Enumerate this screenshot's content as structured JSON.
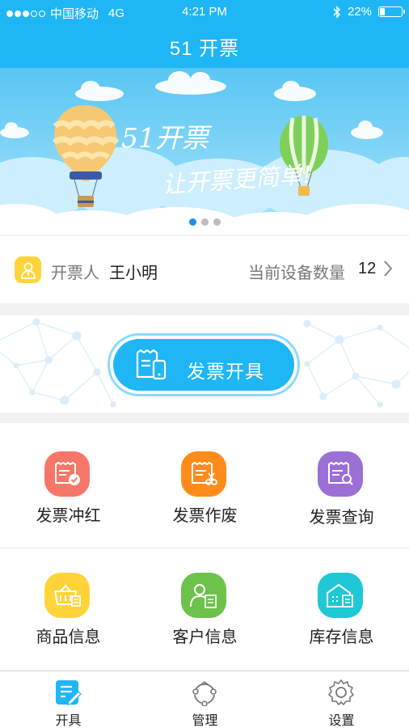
{
  "status": {
    "carrier": "中国移动",
    "network": "4G",
    "time": "4:21 PM",
    "battery": "22%",
    "battery_level": 0.22
  },
  "header": {
    "title": "51 开票"
  },
  "banner": {
    "line1": "51开票",
    "line2": "让开票更简单!",
    "page_count": 3,
    "active_page": 1
  },
  "issuer": {
    "label": "开票人",
    "name": "王小明",
    "device_label": "当前设备数量",
    "device_count": "12"
  },
  "issue_button": {
    "label": "发票开具"
  },
  "grid": {
    "items": [
      {
        "label": "发票冲红",
        "icon": "invoice-check-icon",
        "color": "#f7766a"
      },
      {
        "label": "发票作废",
        "icon": "invoice-cut-icon",
        "color": "#ff8c1a"
      },
      {
        "label": "发票查询",
        "icon": "invoice-search-icon",
        "color": "#9b6fd6"
      },
      {
        "label": "商品信息",
        "icon": "basket-icon",
        "color": "#ffd43b"
      },
      {
        "label": "客户信息",
        "icon": "customer-icon",
        "color": "#6cc24a"
      },
      {
        "label": "库存信息",
        "icon": "warehouse-icon",
        "color": "#1ec8d6"
      }
    ]
  },
  "tabbar": {
    "tabs": [
      {
        "label": "开具",
        "icon": "issue-tab-icon",
        "active": true
      },
      {
        "label": "管理",
        "icon": "manage-tab-icon",
        "active": false
      },
      {
        "label": "设置",
        "icon": "settings-tab-icon",
        "active": false
      }
    ]
  },
  "colors": {
    "primary": "#1fb6f5",
    "accent_light": "#8ad9fb",
    "pager_active": "#1e90e6"
  }
}
